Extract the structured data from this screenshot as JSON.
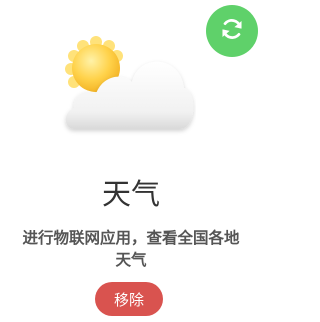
{
  "app": {
    "title": "天气",
    "description_line1": "进行物联网应用，查看全国各地",
    "description_line2": "天气",
    "icon": "sun-cloud-icon"
  },
  "actions": {
    "refresh_icon": "refresh-icon",
    "refresh_color": "#5fd16a",
    "remove_label": "移除",
    "remove_color": "#d9534f"
  }
}
